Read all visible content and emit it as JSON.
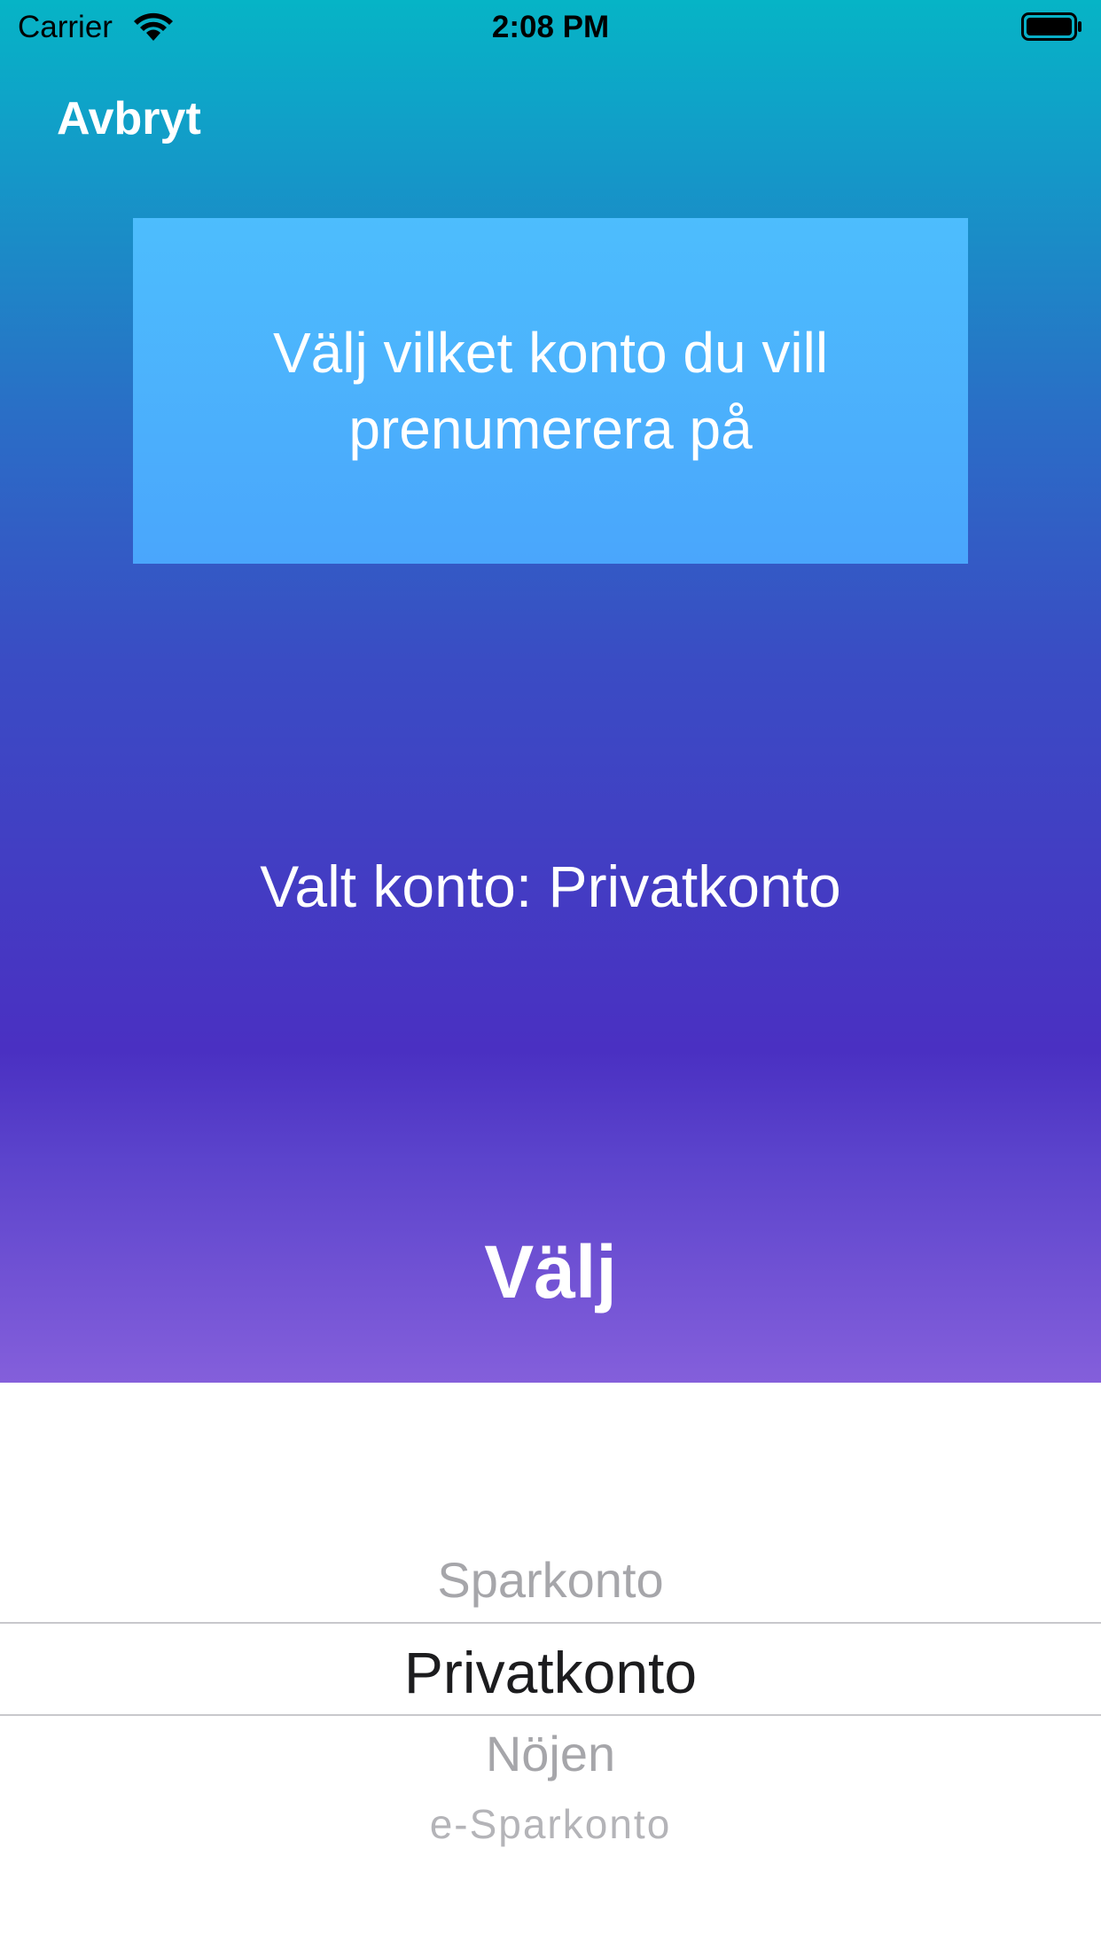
{
  "status_bar": {
    "carrier": "Carrier",
    "time": "2:08 PM",
    "wifi_icon": "wifi-icon",
    "battery_icon": "battery-icon"
  },
  "nav": {
    "cancel_label": "Avbryt"
  },
  "prompt": {
    "text": "Välj vilket konto du vill prenumerera på"
  },
  "selection": {
    "text": "Valt konto: Privatkonto"
  },
  "actions": {
    "choose_label": "Välj"
  },
  "picker": {
    "options": [
      "Sparkonto",
      "Privatkonto",
      "Nöjen",
      "e-Sparkonto"
    ],
    "selected": "Privatkonto"
  },
  "colors": {
    "gradient_top": "#06b4c6",
    "gradient_mid": "#4a30c2",
    "gradient_bottom": "#845fdb",
    "prompt_box": "#4dbdfd",
    "text_light": "#ffffff"
  }
}
